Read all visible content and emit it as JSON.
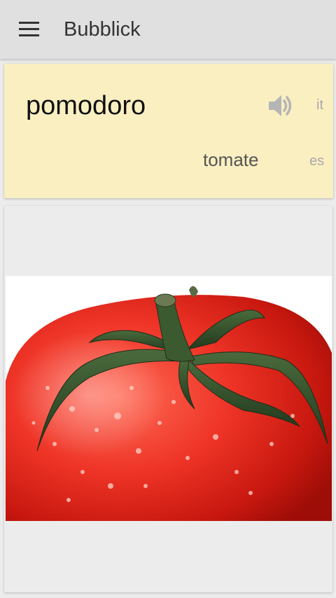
{
  "appbar": {
    "title": "Bubblick",
    "menu_icon": "hamburger-menu-icon"
  },
  "word_card": {
    "word": "pomodoro",
    "source_lang": "it",
    "translation": "tomate",
    "target_lang": "es",
    "speaker_icon": "speaker-icon",
    "background_color": "#faefc1"
  },
  "image_card": {
    "subject": "tomato-image"
  },
  "colors": {
    "appbar": "#e0e0e0",
    "background": "#ececec",
    "tomato_red": "#e8332a",
    "stem_green": "#2f4a2a"
  }
}
